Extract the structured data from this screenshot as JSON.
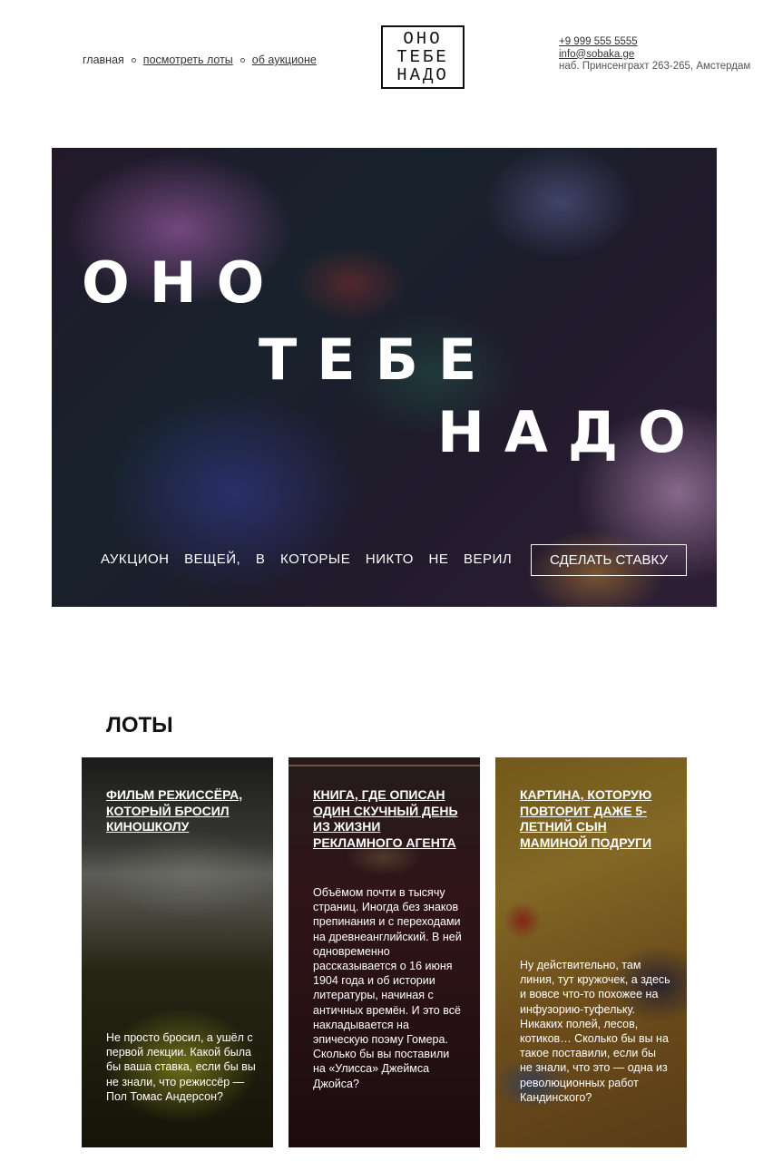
{
  "nav": {
    "home": "главная",
    "lots": "посмотреть лоты",
    "about": "об аукционе"
  },
  "logo": [
    "ОНО",
    "ТЕБЕ",
    "НАДО"
  ],
  "contacts": {
    "phone": "+9 999 555 5555",
    "email": "info@sobaka.ge",
    "address": "наб. Принсенграхт 263-265, Амстердам"
  },
  "hero": {
    "word1": "ОНО",
    "word2": "ТЕБЕ",
    "word3": "НАДО",
    "subtitle": "АУКЦИОН ВЕЩЕЙ, В КОТОРЫЕ НИКТО НЕ ВЕРИЛ",
    "cta": "СДЕЛАТЬ СТАВКУ"
  },
  "lots": {
    "title": "ЛОТЫ",
    "items": [
      {
        "title": "ФИЛЬМ РЕЖИССЁРА, КОТОРЫЙ БРОСИЛ КИНОШКОЛУ",
        "text": "Не просто бросил, а ушёл с первой лекции. Какой была бы ваша ставка, если бы вы не знали, что режиссёр — Пол Томас Андерсон?"
      },
      {
        "title": "КНИГА, ГДЕ ОПИСАН ОДИН СКУЧНЫЙ ДЕНЬ ИЗ ЖИЗНИ РЕКЛАМНОГО АГЕНТА",
        "text": "Объёмом почти в тысячу страниц. Иногда без знаков препинания и с переходами на древнеанглийский. В ней одновременно рассказывается о 16 июня 1904 года и об истории литературы, начиная с античных времён. И это всё накладывается на эпическую поэму Гомера. Сколько бы вы поставили на «Улисса» Джеймса Джойса?"
      },
      {
        "title": "КАРТИНА, КОТОРУЮ ПОВТОРИТ ДАЖЕ 5-ЛЕТНИЙ СЫН МАМИНОЙ ПОДРУГИ",
        "text": "Ну действительно, там линия, тут кружочек, а здесь и вовсе что-то похожее на инфузорию-туфельку. Никаких полей, лесов, котиков… Сколько бы вы на такое поставили, если бы не знали, что это — одна из революционных работ Кандинского?"
      }
    ]
  }
}
